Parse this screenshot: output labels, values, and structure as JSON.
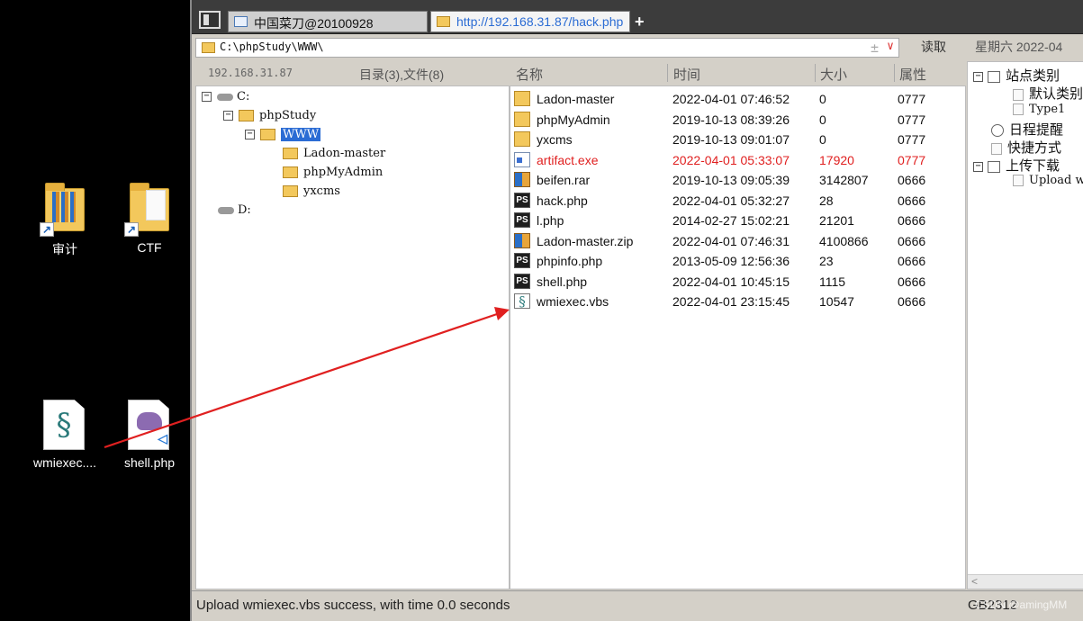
{
  "desktop": {
    "icons": [
      {
        "label": "审计",
        "icon": "folder-shortcut-icon"
      },
      {
        "label": "CTF",
        "icon": "folder-shortcut-icon"
      },
      {
        "label": "wmiexec....",
        "icon": "vbs-script-icon"
      },
      {
        "label": "shell.php",
        "icon": "php-file-icon"
      }
    ]
  },
  "tabs": [
    {
      "label": "中国菜刀@20100928",
      "icon": "window-icon"
    },
    {
      "label": "http://192.168.31.87/hack.php",
      "icon": "folder-icon"
    }
  ],
  "tab_add": "+",
  "address": {
    "path": "C:\\phpStudy\\WWW\\",
    "plus": "±",
    "dropdown": "∨",
    "read_button": "读取",
    "date": "星期六 2022-04"
  },
  "left_header": {
    "ip": "192.168.31.87",
    "count": "目录(3),文件(8)"
  },
  "columns": {
    "name": "名称",
    "time": "时间",
    "size": "大小",
    "attr": "属性"
  },
  "tree": {
    "drive_c": "C:",
    "phpstudy": "phpStudy",
    "www": "WWW",
    "children": [
      "Ladon-master",
      "phpMyAdmin",
      "yxcms"
    ],
    "drive_d": "D:",
    "collapse_symbol": "−"
  },
  "files": [
    {
      "name": "Ladon-master",
      "time": "2022-04-01 07:46:52",
      "size": "0",
      "attr": "0777",
      "type": "folder"
    },
    {
      "name": "phpMyAdmin",
      "time": "2019-10-13 08:39:26",
      "size": "0",
      "attr": "0777",
      "type": "folder"
    },
    {
      "name": "yxcms",
      "time": "2019-10-13 09:01:07",
      "size": "0",
      "attr": "0777",
      "type": "folder"
    },
    {
      "name": "artifact.exe",
      "time": "2022-04-01 05:33:07",
      "size": "17920",
      "attr": "0777",
      "type": "exe",
      "highlight": "#e02020"
    },
    {
      "name": "beifen.rar",
      "time": "2019-10-13 09:05:39",
      "size": "3142807",
      "attr": "0666",
      "type": "rar"
    },
    {
      "name": "hack.php",
      "time": "2022-04-01 05:32:27",
      "size": "28",
      "attr": "0666",
      "type": "php"
    },
    {
      "name": "l.php",
      "time": "2014-02-27 15:02:21",
      "size": "21201",
      "attr": "0666",
      "type": "php"
    },
    {
      "name": "Ladon-master.zip",
      "time": "2022-04-01 07:46:31",
      "size": "4100866",
      "attr": "0666",
      "type": "rar"
    },
    {
      "name": "phpinfo.php",
      "time": "2013-05-09 12:56:36",
      "size": "23",
      "attr": "0666",
      "type": "php"
    },
    {
      "name": "shell.php",
      "time": "2022-04-01 10:45:15",
      "size": "1115",
      "attr": "0666",
      "type": "php"
    },
    {
      "name": "wmiexec.vbs",
      "time": "2022-04-01 23:15:45",
      "size": "10547",
      "attr": "0666",
      "type": "vbs"
    }
  ],
  "php_icon_text": "PS",
  "vbs_icon_text": "§",
  "sidebar": {
    "site_category": "站点类别",
    "default_category": "默认类别",
    "type1": "Type1",
    "schedule": "日程提醒",
    "shortcuts": "快捷方式",
    "upload_download": "上传下载",
    "upload_item": "Upload w",
    "scroll_left": "<"
  },
  "status": {
    "message": "Upload wmiexec.vbs success, with time 0.0 seconds",
    "encoding": "GB2312"
  },
  "watermark": "CSDN @amingMM",
  "colors": {
    "arrow": "#e02020",
    "accent": "#2b6cd4",
    "error_text": "#e02020"
  }
}
